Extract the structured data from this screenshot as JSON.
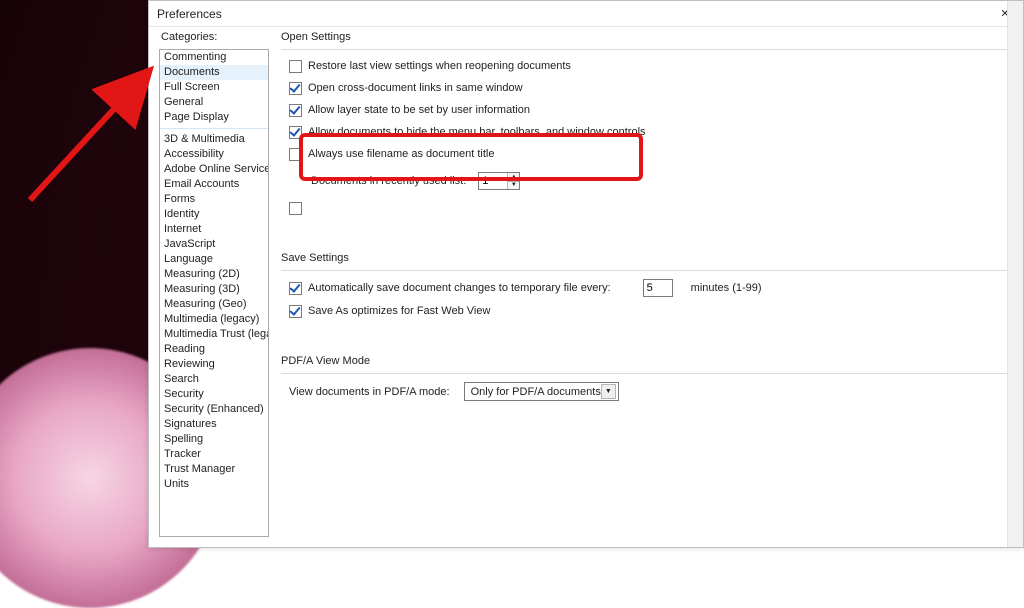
{
  "dialog": {
    "title": "Preferences",
    "close_label": "✕"
  },
  "categories": {
    "label": "Categories:",
    "selected_index": 1,
    "top": [
      "Commenting",
      "Documents",
      "Full Screen",
      "General",
      "Page Display"
    ],
    "rest": [
      "3D & Multimedia",
      "Accessibility",
      "Adobe Online Services",
      "Email Accounts",
      "Forms",
      "Identity",
      "Internet",
      "JavaScript",
      "Language",
      "Measuring (2D)",
      "Measuring (3D)",
      "Measuring (Geo)",
      "Multimedia (legacy)",
      "Multimedia Trust (legacy)",
      "Reading",
      "Reviewing",
      "Search",
      "Security",
      "Security (Enhanced)",
      "Signatures",
      "Spelling",
      "Tracker",
      "Trust Manager",
      "Units"
    ]
  },
  "open_settings": {
    "title": "Open Settings",
    "restore_last_view": {
      "label": "Restore last view settings when reopening documents",
      "checked": false
    },
    "open_cross_doc": {
      "label": "Open cross-document links in same window",
      "checked": true
    },
    "allow_layer_state": {
      "label": "Allow layer state to be set by user information",
      "checked": true
    },
    "allow_hide_menu": {
      "label": "Allow documents to hide the menu bar, toolbars, and window controls",
      "checked": true
    },
    "always_use_filename": {
      "label": "Always use filename as document title",
      "checked": false
    },
    "recent_list": {
      "label": "Documents in recently used list:",
      "value": "1"
    },
    "remember_snapshot": {
      "label": "",
      "checked": false
    }
  },
  "save_settings": {
    "title": "Save Settings",
    "auto_save": {
      "label_before": "Automatically save document changes to temporary file every:",
      "value": "5",
      "label_after": "minutes (1-99)",
      "checked": true
    },
    "fast_web_view": {
      "label": "Save As optimizes for Fast Web View",
      "checked": true
    }
  },
  "pdfa": {
    "title": "PDF/A View Mode",
    "label": "View documents in PDF/A mode:",
    "selected": "Only for PDF/A documents"
  }
}
